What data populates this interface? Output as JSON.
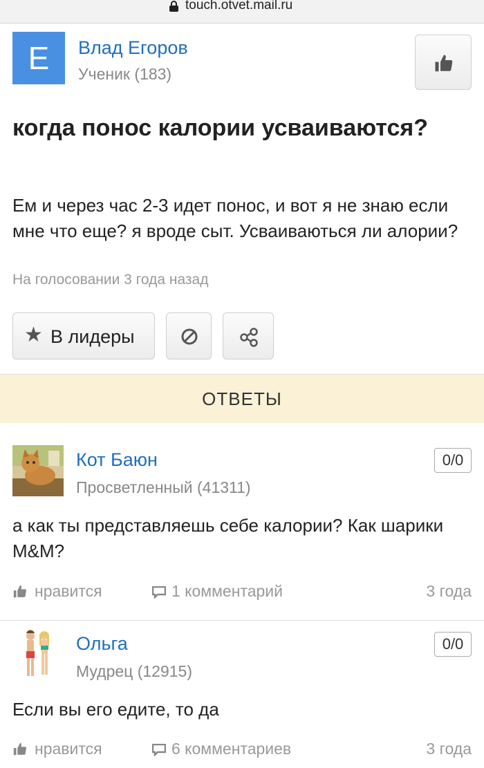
{
  "browser": {
    "url": "touch.otvet.mail.ru"
  },
  "question": {
    "author_initial": "E",
    "author_name": "Влад Егоров",
    "author_rank": "Ученик (183)",
    "title": "когда понос калории усваиваются?",
    "text": "Ем и через час 2-3 идет понос, и вот я не знаю если мне что еще? я вроде сыт. Усваиваються ли алории?",
    "meta": "На голосовании 3 года назад",
    "avatar_color": "#4a90e2"
  },
  "actions": {
    "leaders_label": "В лидеры"
  },
  "answers_header": "ОТВЕТЫ",
  "answers": [
    {
      "name": "Кот Баюн",
      "rank": "Просветленный (41311)",
      "score": "0/0",
      "text": "а как ты представляешь себе калории? Как шарики M&M?",
      "like_label": "нравится",
      "comments": "1 комментарий",
      "time": "3 года"
    },
    {
      "name": "Ольга",
      "rank": "Мудрец (12915)",
      "score": "0/0",
      "text": "Если вы его едите, то да",
      "like_label": "нравится",
      "comments": "6 комментариев",
      "time": "3 года"
    }
  ],
  "colors": {
    "link": "#1f6fbf",
    "answers_bar": "#fbf1d6"
  }
}
